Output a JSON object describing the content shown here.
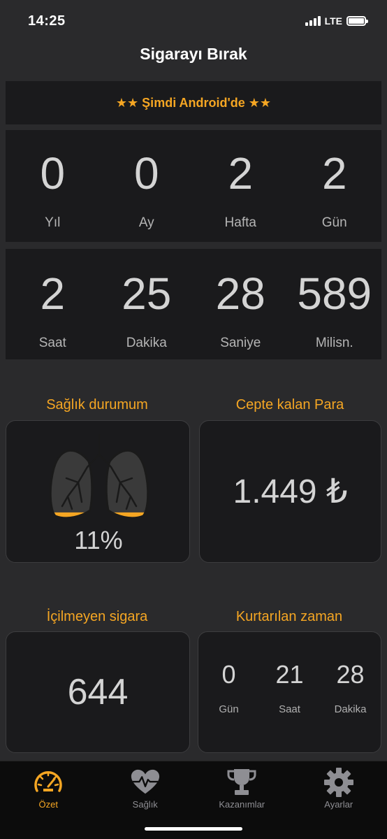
{
  "status_bar": {
    "time": "14:25",
    "network": "LTE"
  },
  "app_title": "Sigarayı Bırak",
  "promo_banner": "★★ Şimdi Android'de ★★",
  "duration_row1": [
    {
      "value": "0",
      "label": "Yıl"
    },
    {
      "value": "0",
      "label": "Ay"
    },
    {
      "value": "2",
      "label": "Hafta"
    },
    {
      "value": "2",
      "label": "Gün"
    }
  ],
  "duration_row2": [
    {
      "value": "2",
      "label": "Saat"
    },
    {
      "value": "25",
      "label": "Dakika"
    },
    {
      "value": "28",
      "label": "Saniye"
    },
    {
      "value": "589",
      "label": "Milisn."
    }
  ],
  "health": {
    "title": "Sağlık durumum",
    "percent_text": "11%",
    "percent": 11
  },
  "money": {
    "title": "Cepte kalan Para",
    "value": "1.449 ₺"
  },
  "cigarettes": {
    "title": "İçilmeyen sigara",
    "value": "644"
  },
  "time_saved": {
    "title": "Kurtarılan zaman",
    "items": [
      {
        "value": "0",
        "label": "Gün"
      },
      {
        "value": "21",
        "label": "Saat"
      },
      {
        "value": "28",
        "label": "Dakika"
      }
    ]
  },
  "tabs": [
    {
      "label": "Özet",
      "icon": "speedometer-icon",
      "active": true
    },
    {
      "label": "Sağlık",
      "icon": "heart-pulse-icon",
      "active": false
    },
    {
      "label": "Kazanımlar",
      "icon": "trophy-icon",
      "active": false
    },
    {
      "label": "Ayarlar",
      "icon": "gear-icon",
      "active": false
    }
  ],
  "colors": {
    "accent": "#f5a623",
    "background": "#2a2a2c",
    "card": "#1a1a1c",
    "inactive_tab": "#8e8e93"
  }
}
